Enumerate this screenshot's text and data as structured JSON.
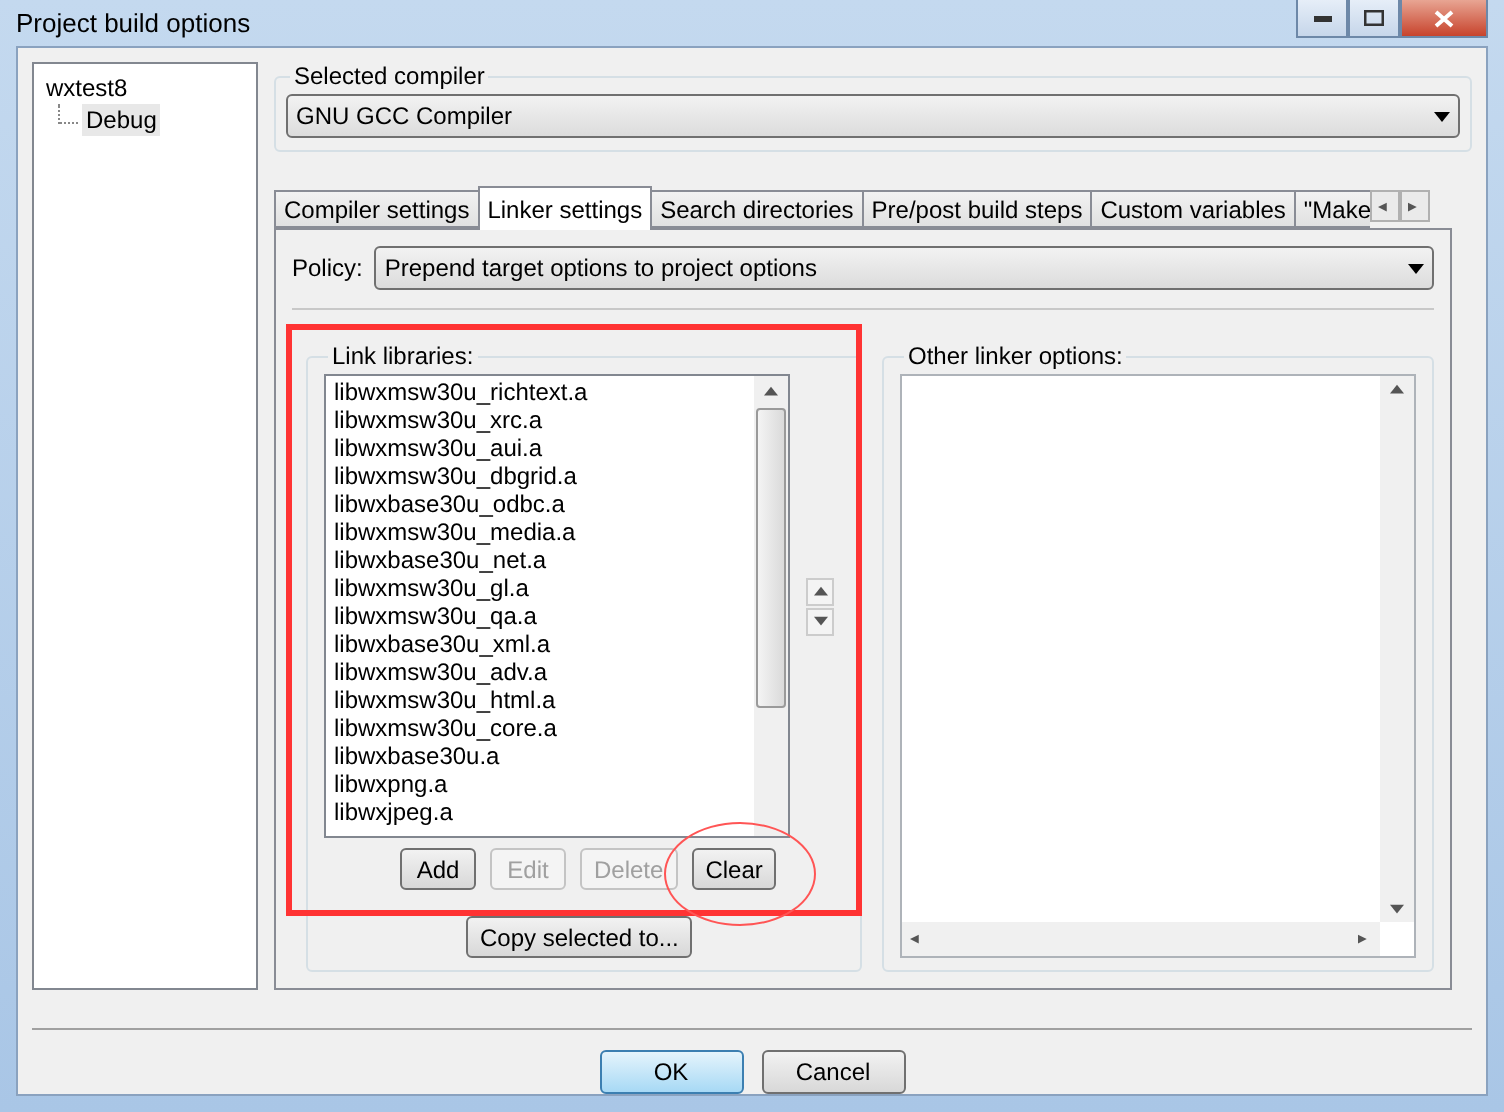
{
  "window": {
    "title": "Project build options"
  },
  "tree": {
    "label": "wxtest8",
    "children": [
      {
        "label": "Debug",
        "selected": true
      }
    ]
  },
  "selected_compiler": {
    "label": "Selected compiler",
    "value": "GNU GCC Compiler"
  },
  "tabs": [
    {
      "label": "Compiler settings",
      "selected": false
    },
    {
      "label": "Linker settings",
      "selected": true
    },
    {
      "label": "Search directories",
      "selected": false
    },
    {
      "label": "Pre/post build steps",
      "selected": false
    },
    {
      "label": "Custom variables",
      "selected": false
    },
    {
      "label": "\"Make",
      "selected": false
    }
  ],
  "policy": {
    "label": "Policy:",
    "value": "Prepend target options to project options"
  },
  "link_libraries": {
    "label": "Link libraries:",
    "items": [
      "libwxmsw30u_richtext.a",
      "libwxmsw30u_xrc.a",
      "libwxmsw30u_aui.a",
      "libwxmsw30u_dbgrid.a",
      "libwxbase30u_odbc.a",
      "libwxmsw30u_media.a",
      "libwxbase30u_net.a",
      "libwxmsw30u_gl.a",
      "libwxmsw30u_qa.a",
      "libwxbase30u_xml.a",
      "libwxmsw30u_adv.a",
      "libwxmsw30u_html.a",
      "libwxmsw30u_core.a",
      "libwxbase30u.a",
      "libwxpng.a",
      "libwxjpeg.a"
    ],
    "buttons": [
      {
        "label": "Add",
        "disabled": false
      },
      {
        "label": "Edit",
        "disabled": true
      },
      {
        "label": "Delete",
        "disabled": true
      },
      {
        "label": "Clear",
        "disabled": false
      }
    ],
    "copy_button": "Copy selected to..."
  },
  "other_linker_options": {
    "label": "Other linker options:"
  },
  "annotations": [
    {
      "kind": "rectangle"
    },
    {
      "kind": "ellipse"
    }
  ],
  "footer_buttons": [
    {
      "label": "OK",
      "default": true
    },
    {
      "label": "Cancel",
      "default": false
    }
  ]
}
